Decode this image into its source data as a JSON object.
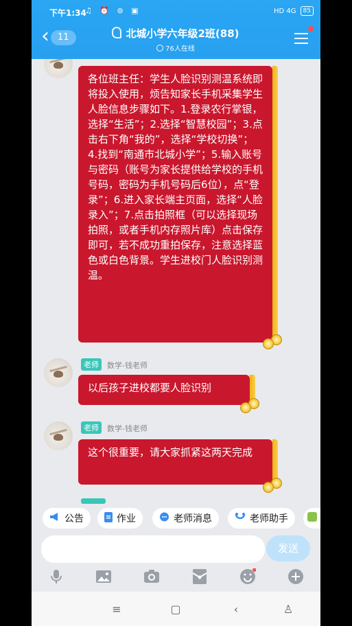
{
  "status_bar": {
    "time": "下午1:34",
    "icons": "♫ ⏰ ⊚ ▣",
    "network": "HD 4G",
    "battery": "85"
  },
  "header": {
    "unread_count": "11",
    "title": "北城小学六年级2班(88)",
    "online": "76人在线"
  },
  "messages": [
    {
      "text": "各位班主任：学生人脸识别测温系统即将投入使用，烦告知家长手机采集学生人脸信息步骤如下。1.登录农行掌银，选择“生活”；2.选择“智慧校园”；3.点击右下角“我的”，选择“学校切换”；4.找到“南通市北城小学”；5.输入账号与密码（账号为家长提供给学校的手机号码，密码为手机号码后6位），点“登录”；6.进入家长端主页面，选择“人脸录入”；7.点击拍照框（可以选择现场拍照，或者手机内存照片库）点击保存即可，若不成功重拍保存，注意选择蓝色或白色背景。学生进校门人脸识别测温。"
    },
    {
      "role": "老师",
      "sender": "数学-钱老师",
      "text": "以后孩子进校都要人脸识别"
    },
    {
      "role": "老师",
      "sender": "数学-钱老师",
      "text": "这个很重要，请大家抓紧这两天完成"
    }
  ],
  "quick_tools": [
    "公告",
    "作业",
    "老师消息",
    "老师助手"
  ],
  "input": {
    "placeholder": "",
    "send_label": "发送"
  },
  "colors": {
    "header": "#27a0f0",
    "bubble": "#c9172d",
    "badge": "#39c6b8"
  }
}
